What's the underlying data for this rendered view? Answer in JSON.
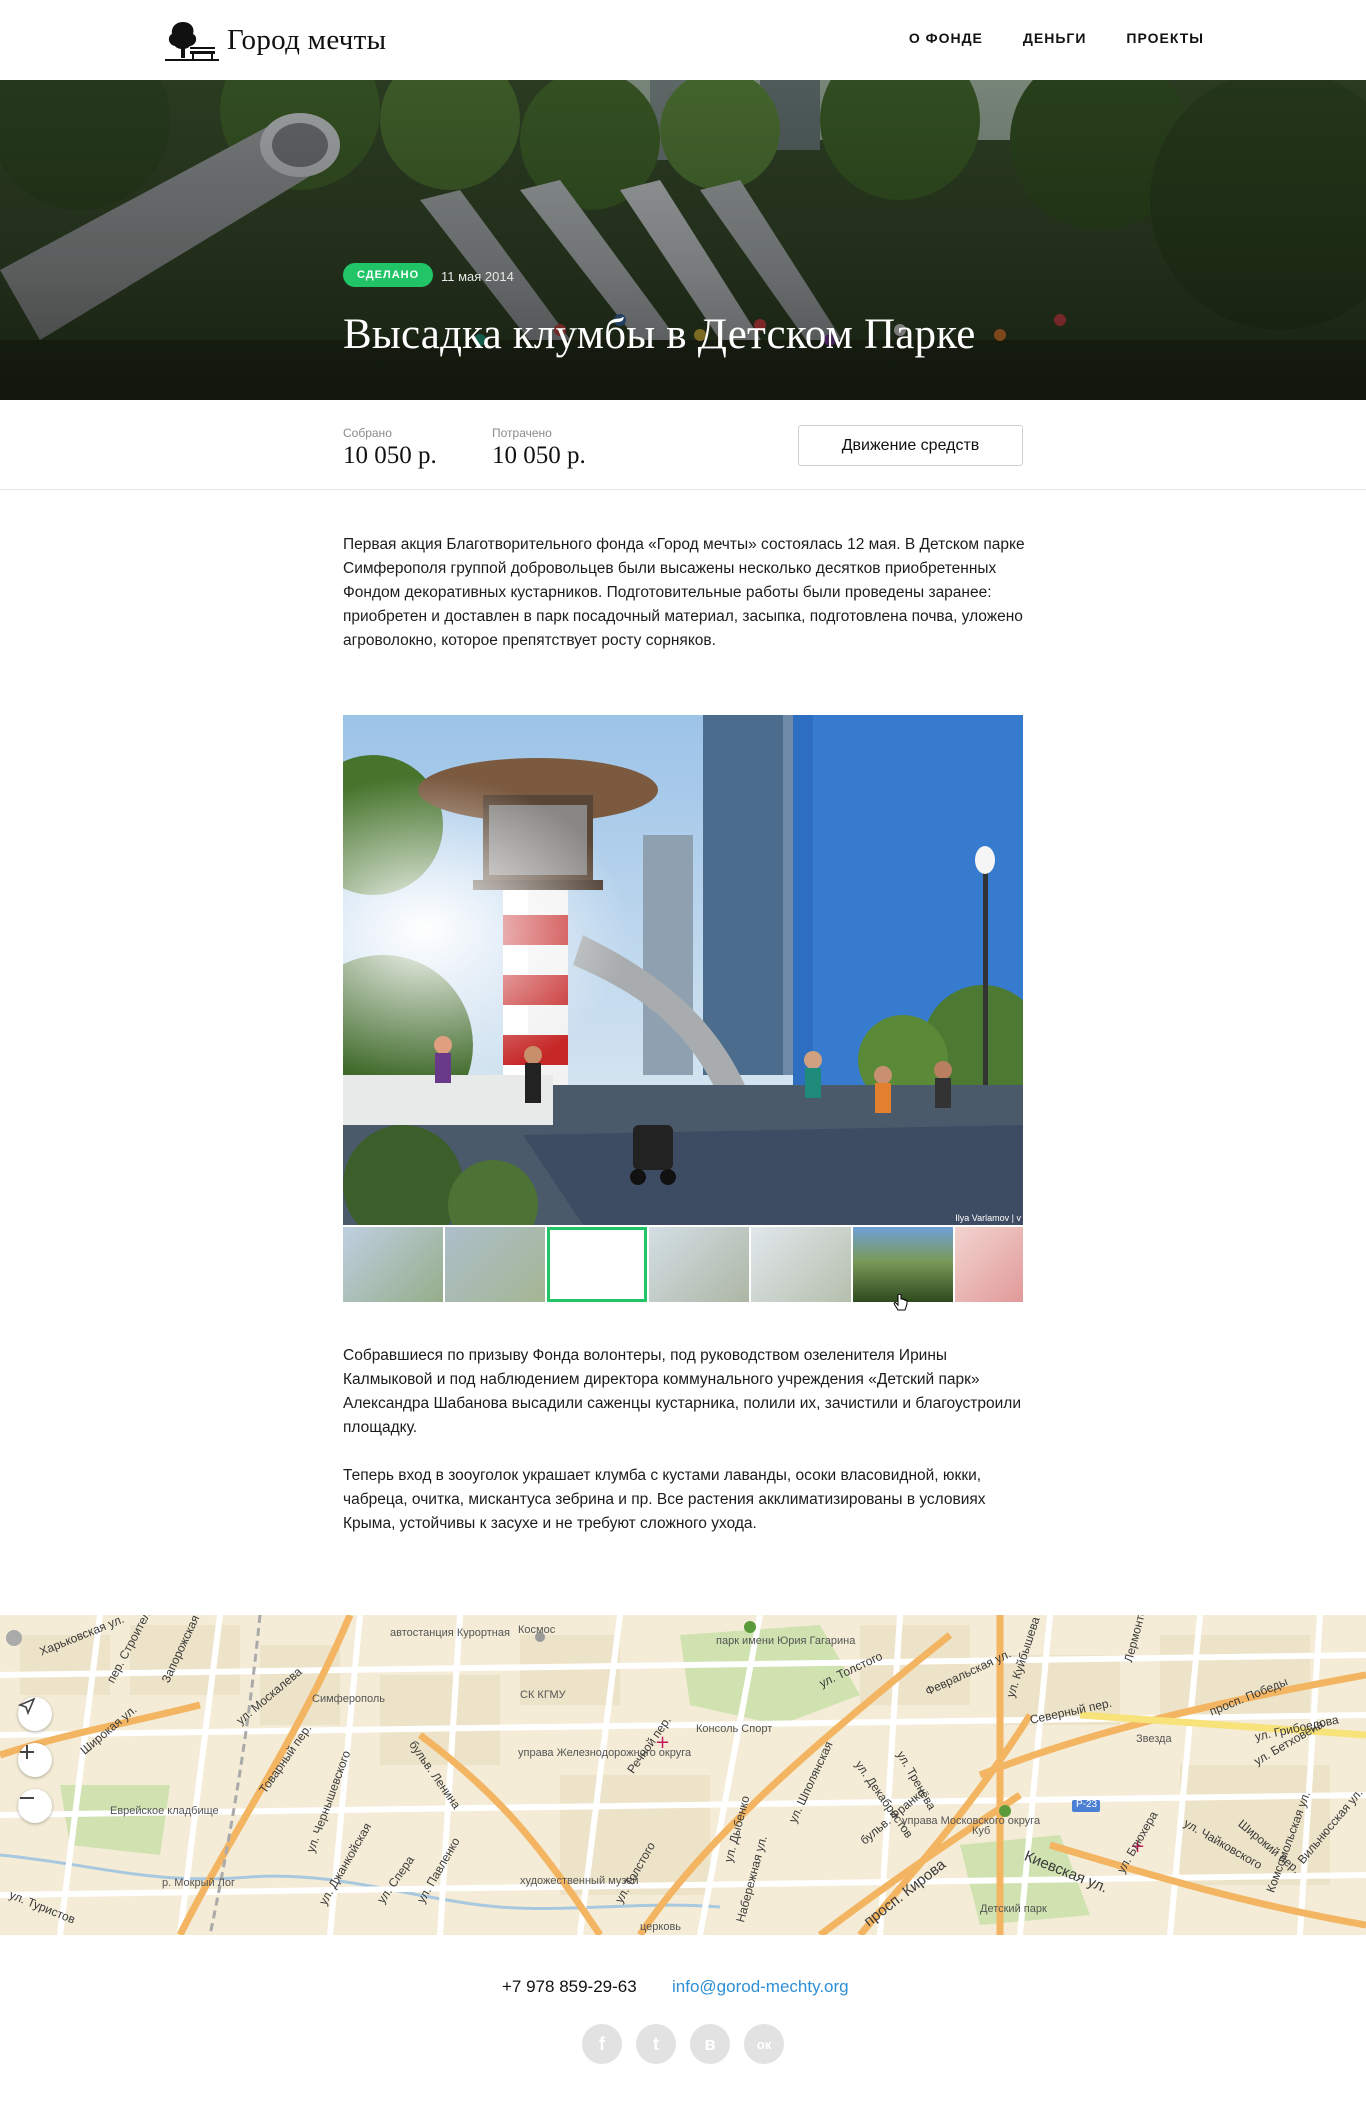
{
  "header": {
    "logo_text": "Город мечты",
    "nav": [
      "О ФОНДЕ",
      "ДЕНЬГИ",
      "ПРОЕКТЫ"
    ]
  },
  "hero": {
    "status": "СДЕЛАНО",
    "date": "11 мая 2014",
    "title": "Высадка клумбы в Детском Парке"
  },
  "stats": {
    "collected_label": "Собрано",
    "collected_value": "10 050 р.",
    "spent_label": "Потрачено",
    "spent_value": "10 050 р.",
    "funds_button": "Движение средств"
  },
  "article": {
    "p1": "Первая акция Благотворительного фонда «Город мечты» состоялась 12 мая. В Детском парке Симферополя группой добровольцев были высажены несколько десятков приобретенных Фондом декоративных кустарников. Подготовительные работы были проведены заранее: приобретен и доставлен в парк посадочный материал, засыпка, подготовлена почва, уложено агроволокно, которое препятствует росту сорняков.",
    "photo_credit": "Ilya Varlamov | v",
    "p2": "Собравшиеся по призыву Фонда волонтеры, под руководством озеленителя Ирины Калмыковой и под наблюдением директора коммунального учреждения «Детский парк» Александра Шабанова высадили саженцы кустарника, полили их, зачистили и благоустроили площадку.",
    "p3": "Теперь вход в зооуголок украшает клумба с кустами лаванды, осоки власовидной, юкки, чабреца, очитка, мискантуса зебрина и пр. Все растения акклиматизированы в условиях Крыма, устойчивы к засухе и не требуют сложного ухода."
  },
  "gallery": {
    "thumbnail_count": 7,
    "active_index": 2,
    "hover_index": 5
  },
  "map": {
    "labels": {
      "kharkovskaya": "Харьковская ул.",
      "stroiteley": "пер. Строителей",
      "zaporozhskaya": "Запорожская ул.",
      "moskaleva": "ул. Москалева",
      "avtostanciya": "автостанция Курортная",
      "simferopol": "Симферополь",
      "kosmos": "Космос",
      "sk_kgmu": "СК КГМУ",
      "park_gagarina": "парк имени Юрия Гагарина",
      "tolstogo": "ул. Толстого",
      "fevralskaya": "Февральская ул.",
      "kuybysheva": "ул. Куйбышева",
      "lermontova": "Лермонтова",
      "prosp_pobedy": "просп. Победы",
      "severnyi": "Северный пер.",
      "zvezda": "Звезда",
      "griboedova": "ул. Грибоедова",
      "shirokaya": "Широкая ул.",
      "tovarniy": "Товарный пер.",
      "bulv_lenina": "бульв. Ленина",
      "upravlenie_zhd": "управа Железнодорожного округа",
      "konsol_sport": "Консоль Спорт",
      "dekabristov": "ул. Декабристов",
      "trenyova": "ул. Тренёва",
      "upravlenie_mosk": "управа Московского округа",
      "kub": "Куб",
      "p23": "Р-23",
      "evreyskoe": "Еврейское кладбище",
      "chernyshevskogo": "ул. Чернышевского",
      "rechnoy": "Речной пер.",
      "dybenko": "ул. Дыбенко",
      "shpolanskaya": "ул. Шполянская",
      "bulv_franko": "бульв. Франко",
      "hudozh_muzey": "художественный музей",
      "turistov": "ул. Туристов",
      "mokriy_log": "р. Мокрый Лог",
      "pavlenko": "ул. Павленко",
      "spera": "ул. Спера",
      "dzhankoyskaya": "ул. Джанкойская",
      "tolstogo2": "ул. Толстого",
      "nabereznaya": "Набережная ул.",
      "kirova": "просп. Кирова",
      "kievskaya": "Киевская ул.",
      "detskiy_park": "Детский парк",
      "blyukhera": "ул. Блюхера",
      "chaykovskogo": "ул. Чайковского",
      "betkhovena": "ул. Бетховена",
      "komsomolskaya": "Комсомольская ул.",
      "shirokiy_per": "Широкий пер.",
      "vilnyusskaya": "Вильнюсская ул.",
      "tserkov": "церковь"
    }
  },
  "footer": {
    "phone": "+7 978 859-29-63",
    "email": "info@gorod-mechty.org",
    "socials": [
      {
        "name": "facebook-icon",
        "glyph": "f"
      },
      {
        "name": "twitter-icon",
        "glyph": "t"
      },
      {
        "name": "vk-icon",
        "glyph": "в"
      },
      {
        "name": "odnoklassniki-icon",
        "glyph": "ок"
      }
    ]
  },
  "colors": {
    "accent_green": "#21c567",
    "link_blue": "#2e8fd6"
  }
}
